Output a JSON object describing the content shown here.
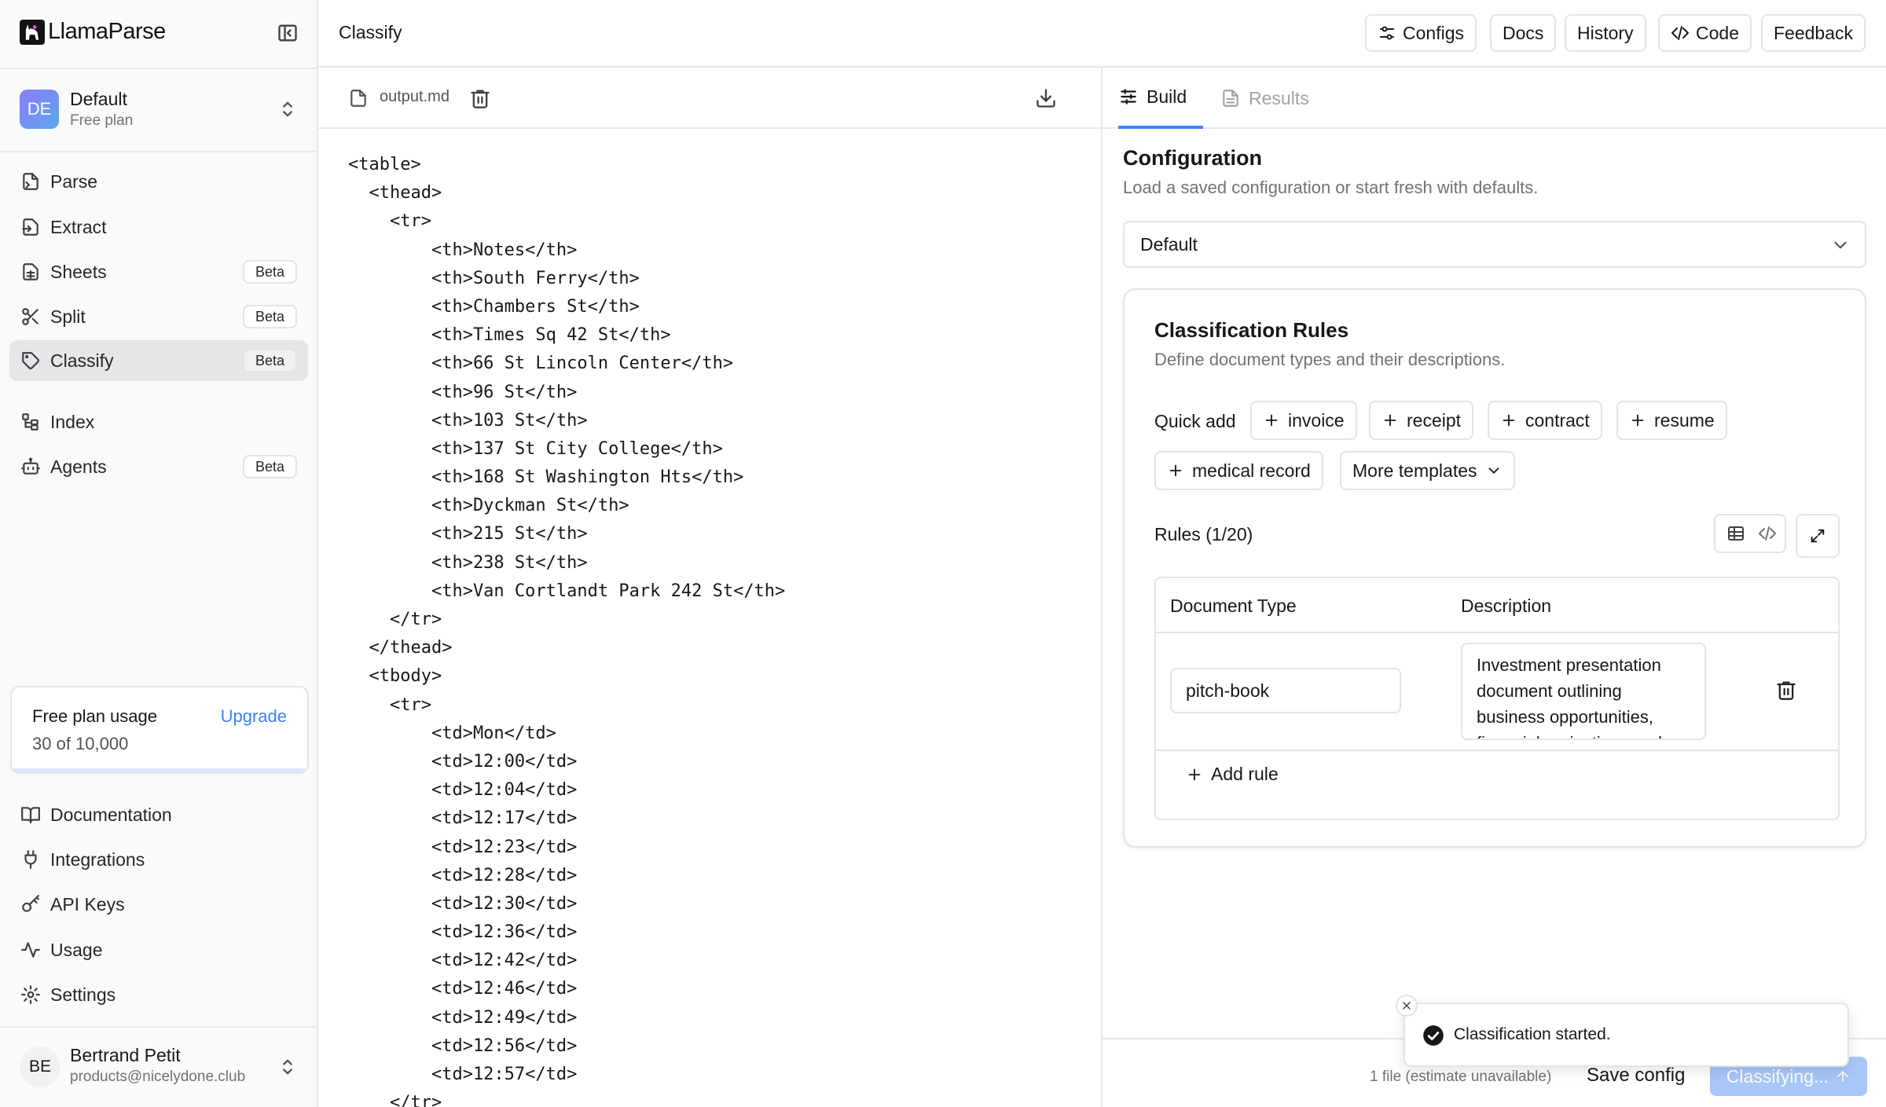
{
  "app": {
    "name": "LlamaParse"
  },
  "workspace": {
    "initials": "DE",
    "name": "Default",
    "plan": "Free plan"
  },
  "nav": [
    {
      "label": "Parse",
      "icon": "parse-icon",
      "badge": ""
    },
    {
      "label": "Extract",
      "icon": "extract-icon",
      "badge": ""
    },
    {
      "label": "Sheets",
      "icon": "sheets-icon",
      "badge": "Beta"
    },
    {
      "label": "Split",
      "icon": "scissors-icon",
      "badge": "Beta"
    },
    {
      "label": "Classify",
      "icon": "tag-icon",
      "badge": "Beta",
      "active": true
    },
    {
      "label": "Index",
      "icon": "index-icon",
      "badge": ""
    },
    {
      "label": "Agents",
      "icon": "bot-icon",
      "badge": "Beta"
    }
  ],
  "usage": {
    "title": "Free plan usage",
    "upgrade": "Upgrade",
    "count": "30 of 10,000",
    "fraction": 0.003
  },
  "bottom_nav": [
    {
      "label": "Documentation",
      "icon": "book-icon"
    },
    {
      "label": "Integrations",
      "icon": "plug-icon"
    },
    {
      "label": "API Keys",
      "icon": "key-icon"
    },
    {
      "label": "Usage",
      "icon": "activity-icon"
    },
    {
      "label": "Settings",
      "icon": "gear-icon"
    }
  ],
  "user": {
    "initials": "BE",
    "name": "Bertrand Petit",
    "email": "products@nicelydone.club"
  },
  "header": {
    "title": "Classify",
    "buttons": {
      "configs": "Configs",
      "docs": "Docs",
      "history": "History",
      "code": "Code",
      "feedback": "Feedback"
    }
  },
  "editor": {
    "file_name": "output.md",
    "lines": [
      "<table>",
      "  <thead>",
      "    <tr>",
      "        <th>Notes</th>",
      "        <th>South Ferry</th>",
      "        <th>Chambers St</th>",
      "        <th>Times Sq 42 St</th>",
      "        <th>66 St Lincoln Center</th>",
      "        <th>96 St</th>",
      "        <th>103 St</th>",
      "        <th>137 St City College</th>",
      "        <th>168 St Washington Hts</th>",
      "        <th>Dyckman St</th>",
      "        <th>215 St</th>",
      "        <th>238 St</th>",
      "        <th>Van Cortlandt Park 242 St</th>",
      "    </tr>",
      "  </thead>",
      "  <tbody>",
      "    <tr>",
      "        <td>Mon</td>",
      "        <td>12:00</td>",
      "        <td>12:04</td>",
      "        <td>12:17</td>",
      "        <td>12:23</td>",
      "        <td>12:28</td>",
      "        <td>12:30</td>",
      "        <td>12:36</td>",
      "        <td>12:42</td>",
      "        <td>12:46</td>",
      "        <td>12:49</td>",
      "        <td>12:56</td>",
      "        <td>12:57</td>",
      "    </tr>"
    ]
  },
  "panel": {
    "tabs": {
      "build": "Build",
      "results": "Results"
    },
    "configuration": {
      "title": "Configuration",
      "description": "Load a saved configuration or start fresh with defaults.",
      "selected": "Default"
    },
    "rules": {
      "title": "Classification Rules",
      "description": "Define document types and their descriptions.",
      "quick_add_label": "Quick add",
      "quick_add": [
        "invoice",
        "receipt",
        "contract",
        "resume",
        "medical record"
      ],
      "more_templates": "More templates",
      "count_label": "Rules (1/20)",
      "col_type": "Document Type",
      "col_description": "Description",
      "rows": [
        {
          "type": "pitch-book",
          "description": "Investment presentation document outlining business opportunities, financial projections and"
        }
      ],
      "add_rule": "Add rule"
    },
    "footer": {
      "estimate": "1 file (estimate unavailable)",
      "save": "Save config",
      "run": "Classifying..."
    },
    "toast": {
      "message": "Classification started."
    }
  },
  "colors": {
    "accent": "#3b82f6",
    "run_disabled": "#a9c6f8",
    "active_nav": "#e6e6e8",
    "success": "#18181b"
  }
}
